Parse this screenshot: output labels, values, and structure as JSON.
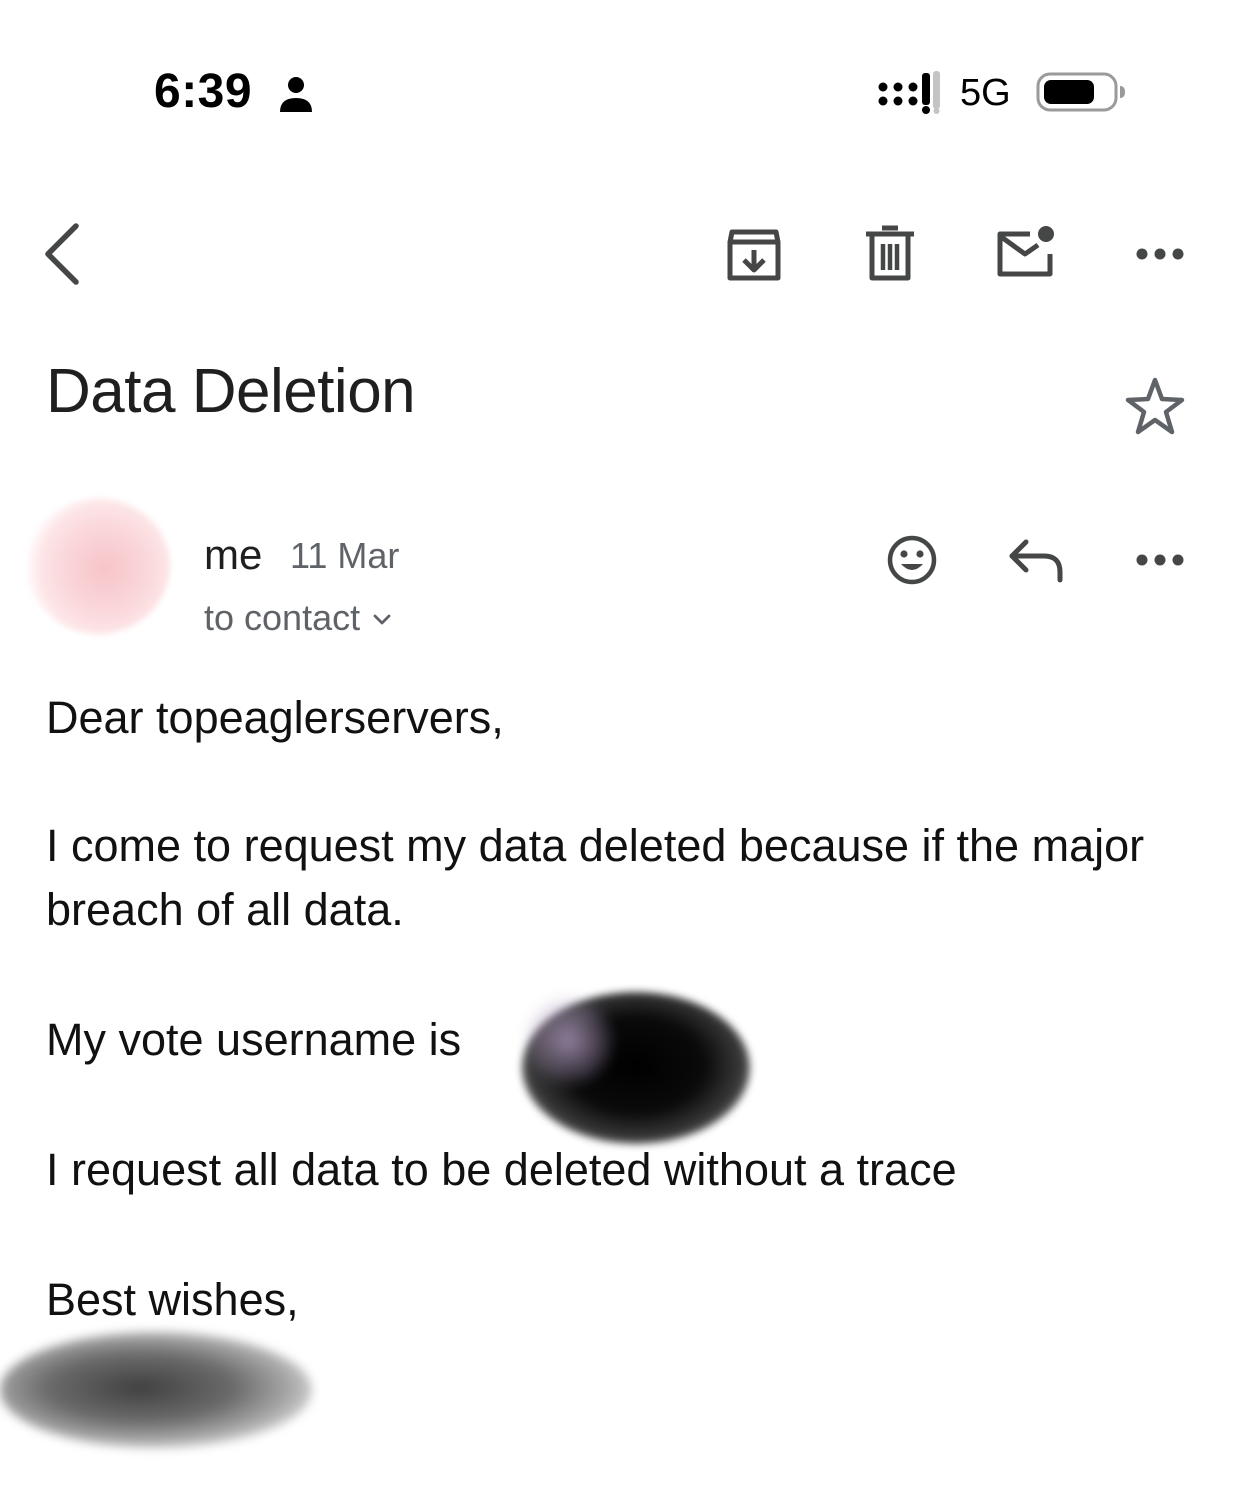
{
  "status_bar": {
    "time": "6:39",
    "network": "5G",
    "icons": [
      "person-icon",
      "signal-icon",
      "battery-icon"
    ]
  },
  "toolbar": {
    "icons": [
      "back-icon",
      "archive-icon",
      "delete-icon",
      "mark-unread-icon",
      "more-icon"
    ]
  },
  "email": {
    "subject": "Data Deletion",
    "starred": false,
    "sender": {
      "name": "me",
      "date": "11 Mar",
      "recipient_line": "to contact"
    },
    "body": {
      "greeting": "Dear topeaglerservers,",
      "paragraph_request": "I come to request my data deleted because if the major breach of all data.",
      "username_line": "My vote username is",
      "trace_line": "I request all data to be deleted without a trace",
      "closing": "Best wishes,"
    }
  },
  "colors": {
    "text": "#111111",
    "secondary_text": "#5f6368",
    "icon": "#444746",
    "background": "#ffffff"
  }
}
